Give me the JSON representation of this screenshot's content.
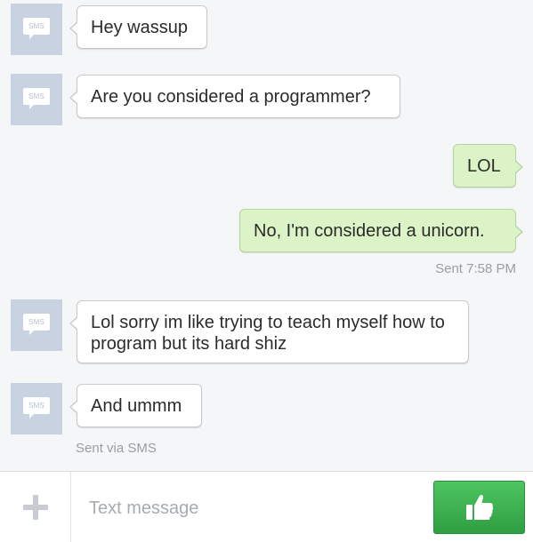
{
  "messages": [
    {
      "text": "Hey wassup",
      "direction": "incoming",
      "avatar_label": "SMS"
    },
    {
      "text": "Are you considered a programmer?",
      "direction": "incoming",
      "avatar_label": "SMS"
    },
    {
      "text": "LOL",
      "direction": "outgoing"
    },
    {
      "text": "No, I'm considered a unicorn.",
      "direction": "outgoing"
    },
    {
      "text": "Lol sorry im like trying to teach myself how to program but its hard shiz",
      "direction": "incoming",
      "avatar_label": "SMS"
    },
    {
      "text": "And ummm",
      "direction": "incoming",
      "avatar_label": "SMS"
    }
  ],
  "meta": {
    "sent_time": "Sent 7:58 PM",
    "sent_via": "Sent via SMS"
  },
  "composer": {
    "placeholder": "Text message",
    "add_icon": "plus-icon",
    "send_icon": "thumbs-up-icon"
  },
  "colors": {
    "incoming_bubble": "#ffffff",
    "outgoing_bubble": "#dcf3c7",
    "avatar": "#c9d2e0",
    "send_button": "#3bb24e"
  }
}
